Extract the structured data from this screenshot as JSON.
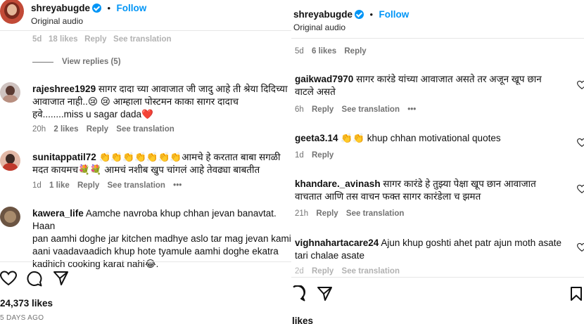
{
  "left": {
    "header": {
      "username": "shreyabugde",
      "follow_label": "Follow",
      "audio": "Original audio"
    },
    "top_meta": "5d   18 likes   Reply   See translation",
    "view_replies": "View replies (5)",
    "comments": [
      {
        "username": "rajeshree1929",
        "text_line1": "सागर दादा च्या आवाजात जी जादु आहे ती श्रेया दिदिच्या",
        "text_line2": "आवाजात नाही..😢 😢 आम्हाला पोस्टमन काका सागर दादाच",
        "text_line3": "हवे........miss u sagar dada❤️",
        "time": "20h",
        "likes": "2 likes",
        "reply": "Reply",
        "translation": "See translation"
      },
      {
        "username": "sunitappatil72",
        "emojis": "👏👏👏👏👏👏👏",
        "text_line1": "आमचे हे करतात बाबा सगळी",
        "text_line2": "मदत कायमच💐💐 आमचं नशीब खुप चांगलं आहे तेवढ्या बाबतीत",
        "time": "1d",
        "likes": "1 like",
        "reply": "Reply",
        "translation": "See translation",
        "more": "•••"
      },
      {
        "username": "kawera_life",
        "text_line1": "Aamche navroba khup chhan jevan banavtat. Haan",
        "text_line2": "pan aamhi doghe jar kitchen madhye aslo tar mag jevan kami",
        "text_line3": "aani vaadavaadich khup hote tyamule aamhi doghe ekatra",
        "text_line4": "kadhich cooking karat nahi😂."
      }
    ],
    "likes": "24,373 likes",
    "date": "5 DAYS AGO"
  },
  "right": {
    "header": {
      "username": "shreyabugde",
      "follow_label": "Follow",
      "audio": "Original audio"
    },
    "top_meta": {
      "time": "5d",
      "likes": "6 likes",
      "reply": "Reply"
    },
    "comments": [
      {
        "username": "gaikwad7970",
        "text_line1": "सागर कारंडे यांच्या आवाजात असते तर अजून खूप छान",
        "text_line2": "वाटले असते",
        "time": "6h",
        "reply": "Reply",
        "translation": "See translation",
        "more": "•••"
      },
      {
        "username": "geeta3.14",
        "emojis": "👏👏",
        "text_line1": "khup chhan motivational quotes",
        "time": "1d",
        "reply": "Reply"
      },
      {
        "username": "khandare._avinash",
        "text_line1": "सागर कारंडे हे तुझ्या पेक्षा खूप छान आवाजात",
        "text_line2": "वाचतात आणि तस वाचन फक्त सागर कारंडेला च झमत",
        "time": "21h",
        "reply": "Reply",
        "translation": "See translation"
      },
      {
        "username": "vighnahartacare24",
        "text_line1": "Ajun khup goshti ahet patr ajun moth asate",
        "text_line2": "tari chalae asate",
        "time": "2d",
        "reply": "Reply",
        "translation": "See translation"
      }
    ],
    "likes": "likes"
  }
}
